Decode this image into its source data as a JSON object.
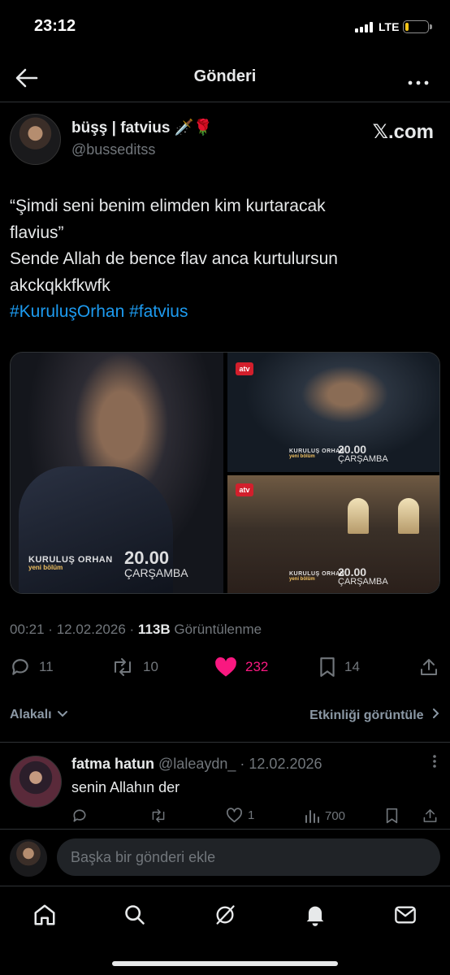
{
  "status_bar": {
    "time": "23:12",
    "network": "LTE",
    "battery_level": 0.15,
    "battery_color": "#f5c518"
  },
  "nav": {
    "title": "Gönderi",
    "back_icon": "arrow-left-icon",
    "more_icon": "more-horizontal-icon"
  },
  "post": {
    "author_name": "büşş | fatvius 🗡️🌹",
    "author_handle": "@busseditss",
    "source": "𝕏.com",
    "text_lines": [
      "“Şimdi seni benim elimden kim kurtaracak",
      "flavius”",
      "Sende Allah de bence flav anca kurtulursun",
      "akckqkkfkwfk"
    ],
    "hashtags": [
      "#KuruluşOrhan",
      "#fatvius"
    ],
    "media": {
      "overlay_title": "KURULUŞ ORHAN",
      "overlay_subtitle": "yeni bölüm",
      "overlay_time": "20.00",
      "overlay_day": "ÇARŞAMBA",
      "channel": "atv"
    },
    "meta": {
      "time": "00:21",
      "date": "12.02.2026",
      "views": "113B",
      "views_label": "Görüntülenme",
      "separator": "·"
    },
    "actions": {
      "replies": "11",
      "reposts": "10",
      "likes": "232",
      "bookmarks": "14"
    },
    "like_color": "#f91880"
  },
  "relevance": {
    "sort_label": "Alakalı",
    "activity_label": "Etkinliği görüntüle"
  },
  "reply": {
    "name": "fatma hatun",
    "handle": "@laleaydn_",
    "separator": "·",
    "date": "12.02.2026",
    "text": "senin Allahın der",
    "likes": "1",
    "views": "700"
  },
  "composer": {
    "placeholder": "Başka bir gönderi ekle"
  },
  "tabbar": {
    "icons": [
      "home-icon",
      "search-icon",
      "grok-icon",
      "notifications-icon",
      "messages-icon"
    ]
  }
}
